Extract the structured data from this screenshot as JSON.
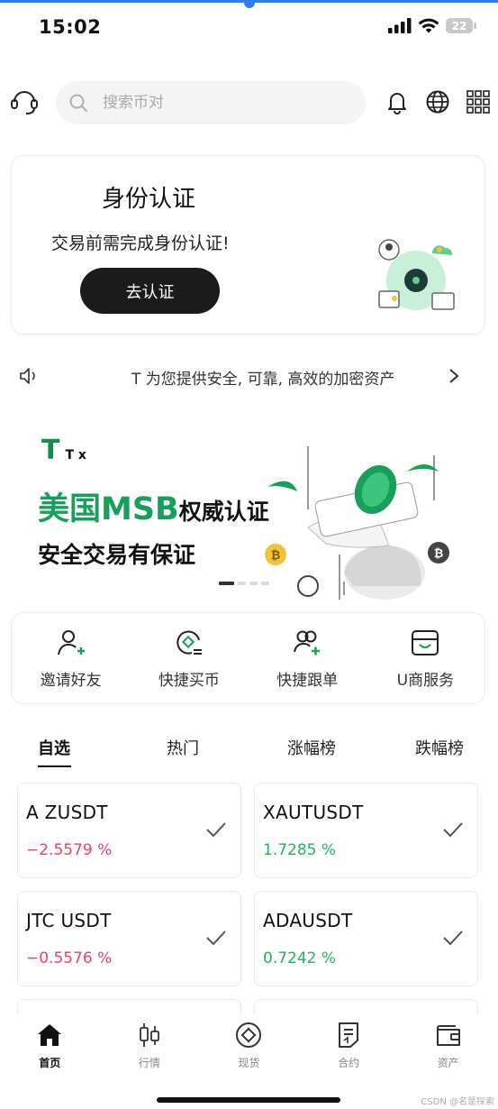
{
  "status_bar": {
    "time": "15:02",
    "battery": "22"
  },
  "header": {
    "search_placeholder": "搜索币对"
  },
  "verify_card": {
    "title": "身份认证",
    "description": "交易前需完成身份认证!",
    "button_label": "去认证"
  },
  "notice": {
    "text": "T  为您提供安全, 可靠, 高效的加密资产"
  },
  "banner": {
    "logo_letter": "T",
    "logo_name": "T  x",
    "line1_green": "美国MSB",
    "line1_black": "权威认证",
    "line2": "安全交易有保证",
    "slide_count": 4,
    "active_slide": 1
  },
  "quick_actions": [
    {
      "label": "邀请好友",
      "icon": "invite-user-icon"
    },
    {
      "label": "快捷买币",
      "icon": "quick-buy-icon"
    },
    {
      "label": "快捷跟单",
      "icon": "copy-trade-icon"
    },
    {
      "label": "U商服务",
      "icon": "merchant-icon"
    }
  ],
  "market_tabs": [
    {
      "label": "自选",
      "active": true
    },
    {
      "label": "热门",
      "active": false
    },
    {
      "label": "涨幅榜",
      "active": false
    },
    {
      "label": "跌幅榜",
      "active": false
    }
  ],
  "market_cards": [
    {
      "symbol": "A  ZUSDT",
      "change": "−2.5579 %",
      "direction": "down"
    },
    {
      "symbol": "XAUTUSDT",
      "change": "1.7285 %",
      "direction": "up"
    },
    {
      "symbol": "JTC USDT",
      "change": "−0.5576 %",
      "direction": "down"
    },
    {
      "symbol": "ADAUSDT",
      "change": "0.7242 %",
      "direction": "up"
    }
  ],
  "colors": {
    "down": "#e8436b",
    "up": "#22b45e",
    "brand": "#17a05a"
  },
  "bottom_nav": [
    {
      "label": "首页",
      "icon": "home-icon",
      "active": true
    },
    {
      "label": "行情",
      "icon": "candlestick-icon",
      "active": false
    },
    {
      "label": "现货",
      "icon": "spot-icon",
      "active": false
    },
    {
      "label": "合约",
      "icon": "contract-icon",
      "active": false
    },
    {
      "label": "资产",
      "icon": "wallet-icon",
      "active": false
    }
  ],
  "watermark": "CSDN @名是探索"
}
